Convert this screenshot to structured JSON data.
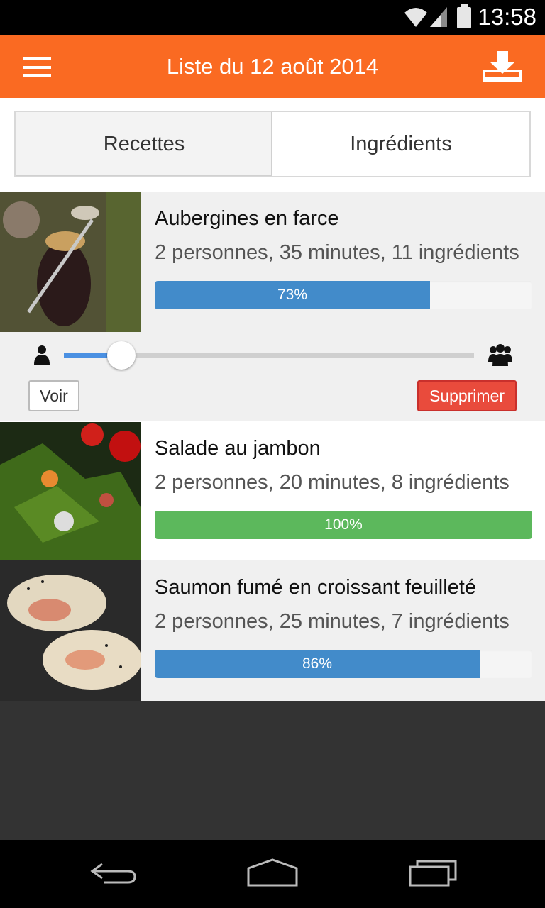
{
  "status_bar": {
    "time": "13:58"
  },
  "header": {
    "title": "Liste du 12 août 2014"
  },
  "tabs": [
    {
      "label": "Recettes",
      "active": true
    },
    {
      "label": "Ingrédients",
      "active": false
    }
  ],
  "recipes": [
    {
      "name": "Aubergines en farce",
      "meta": "2 personnes, 35 minutes, 11 ingrédients",
      "progress_label": "73%",
      "progress": 0.73,
      "bar_color": "#428bca",
      "background": "#f0f0f0"
    },
    {
      "name": "Salade au jambon",
      "meta": "2 personnes, 20 minutes, 8 ingrédients",
      "progress_label": "100%",
      "progress": 1.0,
      "bar_color": "#5cb85c",
      "background": "#ffffff"
    },
    {
      "name": "Saumon fumé en croissant feuilleté",
      "meta": "2 personnes, 25 minutes, 7 ingrédients",
      "progress_label": "86%",
      "progress": 0.86,
      "bar_color": "#428bca",
      "background": "#f0f0f0"
    }
  ],
  "expanded": {
    "servings_slider_level": 0.14,
    "view_label": "Voir",
    "delete_label": "Supprimer"
  },
  "colors": {
    "accent": "#fa6a22",
    "danger": "#e94b3c"
  }
}
